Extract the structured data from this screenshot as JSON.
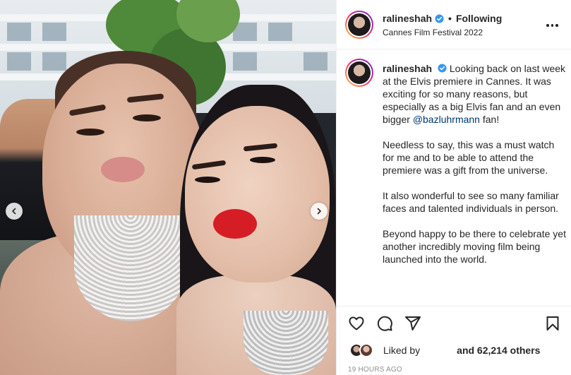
{
  "post": {
    "username": "ralineshah",
    "follow_label": "Following",
    "dot_separator": "•",
    "location": "Cannes Film Festival 2022",
    "caption_paragraphs": [
      "Looking back on last week at the Elvis premiere in Cannes. It was exciting for so many reasons, but especially as a big Elvis fan and an even bigger",
      "Needless to say, this was a must watch for me and to be able to attend the premiere was a gift from the universe.",
      "It also wonderful to see so many familiar faces and talented individuals in person.",
      "Beyond happy to be there to celebrate yet another incredibly moving film being launched into the world."
    ],
    "mention": "@bazluhrmann",
    "mention_suffix": " fan!",
    "liked_by_label": "Liked by",
    "likes_text": "and 62,214 others",
    "timestamp": "19 HOURS AGO"
  },
  "icons": {
    "verified": "verified-badge-icon",
    "more": "more-options-icon",
    "like": "heart-icon",
    "comment": "comment-icon",
    "share": "paper-plane-icon",
    "save": "bookmark-icon",
    "prev": "chevron-left-icon",
    "next": "chevron-right-icon"
  },
  "colors": {
    "verified_blue": "#3897f0",
    "mention_blue": "#00376b",
    "text": "#262626",
    "muted": "#8e8e8e",
    "lipstick_red": "#d51d25"
  }
}
